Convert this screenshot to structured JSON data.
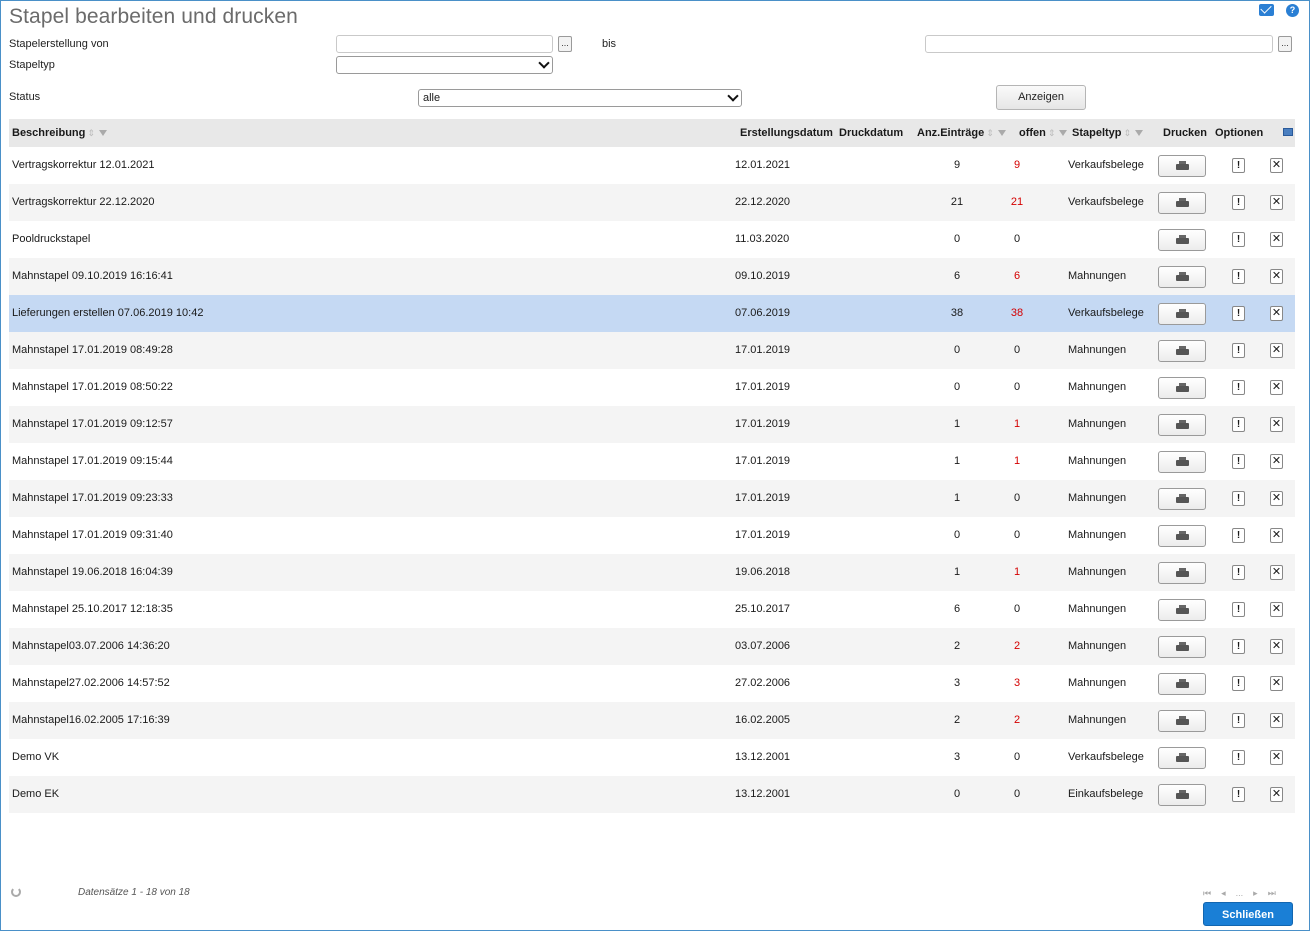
{
  "header": {
    "title": "Stapel bearbeiten und drucken"
  },
  "filters": {
    "created_from_label": "Stapelerstellung von",
    "created_from_value": "",
    "dots": "...",
    "bis_label": "bis",
    "created_to_value": "",
    "type_label": "Stapeltyp",
    "type_value": "",
    "status_label": "Status",
    "status_value": "alle",
    "show_button": "Anzeigen"
  },
  "grid": {
    "columns": {
      "beschreibung": "Beschreibung",
      "erstellungsdatum": "Erstellungsdatum",
      "druckdatum": "Druckdatum",
      "anz": "Anz.Einträge",
      "offen": "offen",
      "stapeltyp": "Stapeltyp",
      "drucken": "Drucken",
      "optionen": "Optionen"
    },
    "rows": [
      {
        "desc": "Vertragskorrektur 12.01.2021",
        "created": "12.01.2021",
        "printed": "",
        "count": "9",
        "open": "9",
        "open_red": true,
        "type": "Verkaufsbelege"
      },
      {
        "desc": "Vertragskorrektur 22.12.2020",
        "created": "22.12.2020",
        "printed": "",
        "count": "21",
        "open": "21",
        "open_red": true,
        "type": "Verkaufsbelege"
      },
      {
        "desc": "Pooldruckstapel",
        "created": "11.03.2020",
        "printed": "",
        "count": "0",
        "open": "0",
        "open_red": false,
        "type": ""
      },
      {
        "desc": "Mahnstapel 09.10.2019 16:16:41",
        "created": "09.10.2019",
        "printed": "",
        "count": "6",
        "open": "6",
        "open_red": true,
        "type": "Mahnungen"
      },
      {
        "desc": "Lieferungen erstellen 07.06.2019 10:42",
        "created": "07.06.2019",
        "printed": "",
        "count": "38",
        "open": "38",
        "open_red": true,
        "type": "Verkaufsbelege",
        "selected": true
      },
      {
        "desc": "Mahnstapel 17.01.2019 08:49:28",
        "created": "17.01.2019",
        "printed": "",
        "count": "0",
        "open": "0",
        "open_red": false,
        "type": "Mahnungen"
      },
      {
        "desc": "Mahnstapel 17.01.2019 08:50:22",
        "created": "17.01.2019",
        "printed": "",
        "count": "0",
        "open": "0",
        "open_red": false,
        "type": "Mahnungen"
      },
      {
        "desc": "Mahnstapel 17.01.2019 09:12:57",
        "created": "17.01.2019",
        "printed": "",
        "count": "1",
        "open": "1",
        "open_red": true,
        "type": "Mahnungen"
      },
      {
        "desc": "Mahnstapel 17.01.2019 09:15:44",
        "created": "17.01.2019",
        "printed": "",
        "count": "1",
        "open": "1",
        "open_red": true,
        "type": "Mahnungen"
      },
      {
        "desc": "Mahnstapel 17.01.2019 09:23:33",
        "created": "17.01.2019",
        "printed": "",
        "count": "1",
        "open": "0",
        "open_red": false,
        "type": "Mahnungen"
      },
      {
        "desc": "Mahnstapel 17.01.2019 09:31:40",
        "created": "17.01.2019",
        "printed": "",
        "count": "0",
        "open": "0",
        "open_red": false,
        "type": "Mahnungen"
      },
      {
        "desc": "Mahnstapel 19.06.2018 16:04:39",
        "created": "19.06.2018",
        "printed": "",
        "count": "1",
        "open": "1",
        "open_red": true,
        "type": "Mahnungen"
      },
      {
        "desc": "Mahnstapel 25.10.2017 12:18:35",
        "created": "25.10.2017",
        "printed": "",
        "count": "6",
        "open": "0",
        "open_red": false,
        "type": "Mahnungen"
      },
      {
        "desc": "Mahnstapel03.07.2006 14:36:20",
        "created": "03.07.2006",
        "printed": "",
        "count": "2",
        "open": "2",
        "open_red": true,
        "type": "Mahnungen"
      },
      {
        "desc": "Mahnstapel27.02.2006 14:57:52",
        "created": "27.02.2006",
        "printed": "",
        "count": "3",
        "open": "3",
        "open_red": true,
        "type": "Mahnungen"
      },
      {
        "desc": "Mahnstapel16.02.2005 17:16:39",
        "created": "16.02.2005",
        "printed": "",
        "count": "2",
        "open": "2",
        "open_red": true,
        "type": "Mahnungen"
      },
      {
        "desc": "Demo VK",
        "created": "13.12.2001",
        "printed": "",
        "count": "3",
        "open": "0",
        "open_red": false,
        "type": "Verkaufsbelege"
      },
      {
        "desc": "Demo EK",
        "created": "13.12.2001",
        "printed": "",
        "count": "0",
        "open": "0",
        "open_red": false,
        "type": "Einkaufsbelege"
      }
    ],
    "opt_glyph": "!",
    "del_glyph": "✕"
  },
  "footer": {
    "records": "Datensätze 1 - 18 von 18",
    "pager_first": "⏮",
    "pager_prev": "◂",
    "pager_ellipsis": "...",
    "pager_next": "▸",
    "pager_last": "⏭",
    "close_button": "Schließen"
  },
  "colors": {
    "accent": "#1a7fd6",
    "selected_row": "#c5d9f3",
    "open_red": "#d40000"
  },
  "icons": [
    "mail-icon",
    "help-icon",
    "printer-icon",
    "options-icon",
    "delete-icon",
    "refresh-icon",
    "column-chooser-icon"
  ]
}
